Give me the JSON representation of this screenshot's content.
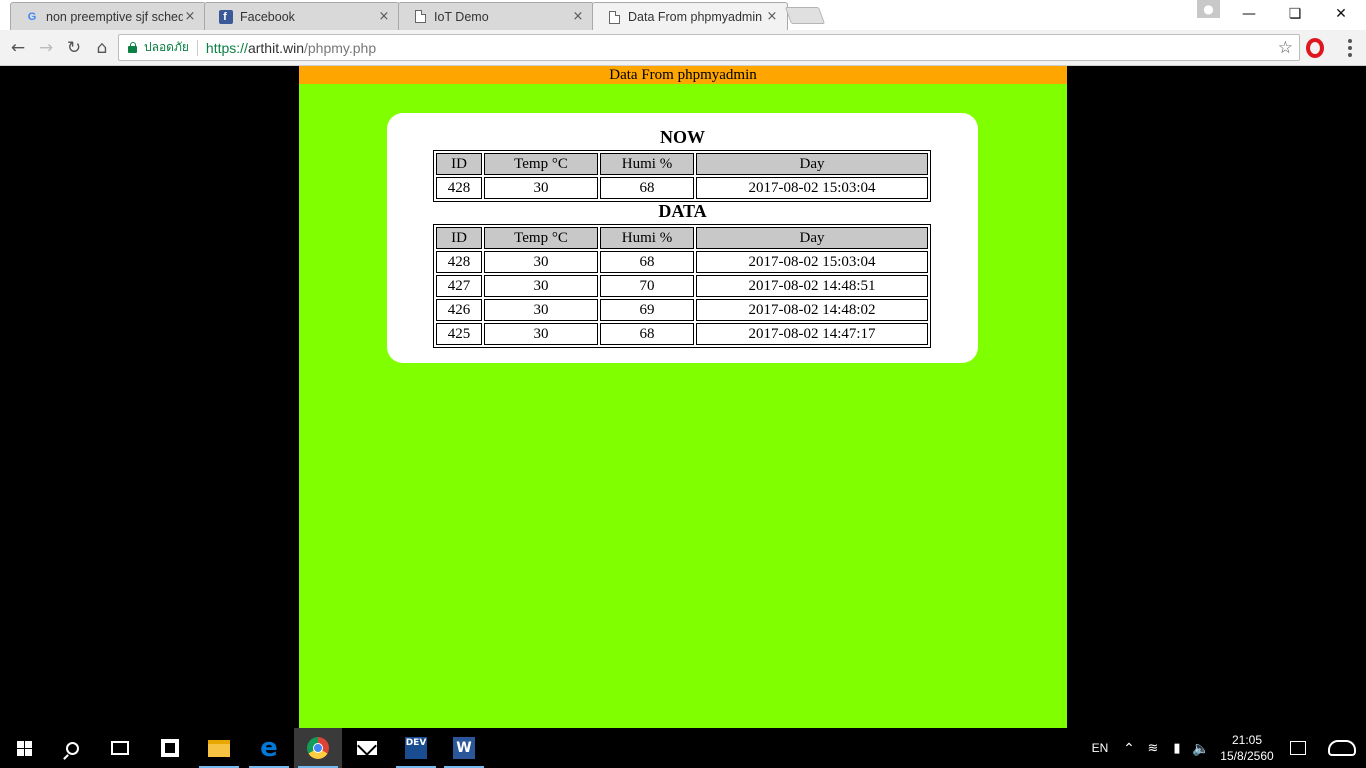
{
  "browser": {
    "tabs": [
      {
        "title": "non preemptive sjf sched",
        "icon": "google-icon",
        "active": false
      },
      {
        "title": "Facebook",
        "icon": "facebook-icon",
        "active": false
      },
      {
        "title": "IoT Demo",
        "icon": "document-icon",
        "active": false
      },
      {
        "title": "Data From phpmyadmin",
        "icon": "document-icon",
        "active": true
      }
    ],
    "tab_close_glyph": "×",
    "secure_label": "ปลอดภัย",
    "url_scheme": "https://",
    "url_host": "arthit.win",
    "url_path": "/phpmy.php"
  },
  "page": {
    "header_title": "Data From phpmyadmin",
    "background_color": "#80ff00",
    "header_color": "#ffa500",
    "now_title": "NOW",
    "data_title": "DATA",
    "columns": [
      "ID",
      "Temp °C",
      "Humi %",
      "Day"
    ],
    "now_rows": [
      [
        "428",
        "30",
        "68",
        "2017-08-02 15:03:04"
      ]
    ],
    "data_rows": [
      [
        "428",
        "30",
        "68",
        "2017-08-02 15:03:04"
      ],
      [
        "427",
        "30",
        "70",
        "2017-08-02 14:48:51"
      ],
      [
        "426",
        "30",
        "69",
        "2017-08-02 14:48:02"
      ],
      [
        "425",
        "30",
        "68",
        "2017-08-02 14:47:17"
      ]
    ]
  },
  "taskbar": {
    "language": "EN",
    "time": "21:05",
    "date": "15/8/2560",
    "dev_label": "DEV",
    "word_label": "W"
  }
}
